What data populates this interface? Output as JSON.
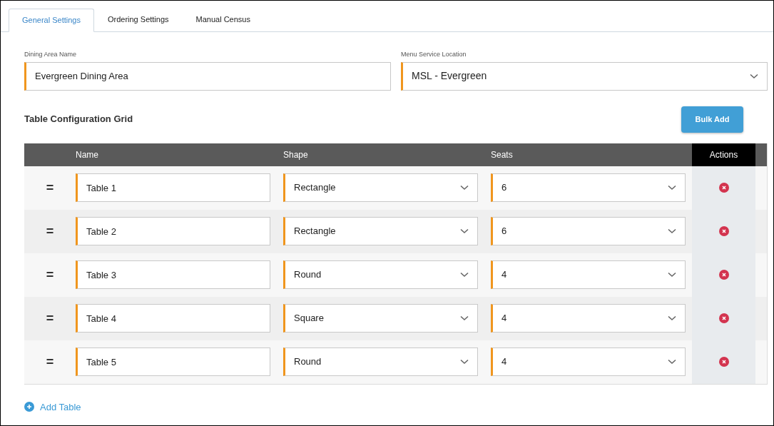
{
  "tabs": [
    {
      "label": "General Settings",
      "selected": true
    },
    {
      "label": "Ordering Settings",
      "selected": false
    },
    {
      "label": "Manual Census",
      "selected": false
    }
  ],
  "dining_area_name": {
    "label": "Dining Area Name",
    "value": "Evergreen Dining Area"
  },
  "menu_service_location": {
    "label": "Menu Service Location",
    "value": "MSL - Evergreen"
  },
  "section_title": "Table Configuration Grid",
  "bulk_add_button": "Bulk Add",
  "table": {
    "columns": [
      "Name",
      "Shape",
      "Seats",
      "Actions"
    ],
    "rows": [
      {
        "handle": "=",
        "name": "Table 1",
        "shape": "Rectangle",
        "seats": "6"
      },
      {
        "handle": "=",
        "name": "Table 2",
        "shape": "Rectangle",
        "seats": "6"
      },
      {
        "handle": "=",
        "name": "Table 3",
        "shape": "Round",
        "seats": "4"
      },
      {
        "handle": "=",
        "name": "Table 4",
        "shape": "Square",
        "seats": "4"
      },
      {
        "handle": "=",
        "name": "Table 5",
        "shape": "Round",
        "seats": "4"
      }
    ]
  },
  "add_table_link": "Add Table"
}
